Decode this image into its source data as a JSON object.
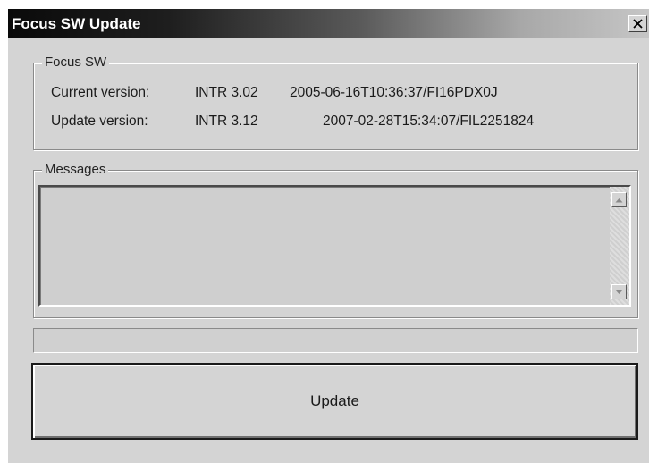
{
  "window": {
    "title": "Focus SW Update",
    "close_label": "X"
  },
  "focus_group": {
    "legend": "Focus SW",
    "current": {
      "label": "Current version:",
      "version": "INTR 3.02",
      "stamp": "2005-06-16T10:36:37/FI16PDX0J"
    },
    "update": {
      "label": "Update version:",
      "version": "INTR 3.12",
      "stamp": "2007-02-28T15:34:07/FIL2251824"
    }
  },
  "messages_group": {
    "legend": "Messages",
    "text": ""
  },
  "progress": {
    "value": 0
  },
  "update_button": {
    "label": "Update"
  },
  "icons": {
    "close": "close-icon",
    "scroll_up": "scroll-up-arrow-icon",
    "scroll_down": "scroll-down-arrow-icon"
  }
}
